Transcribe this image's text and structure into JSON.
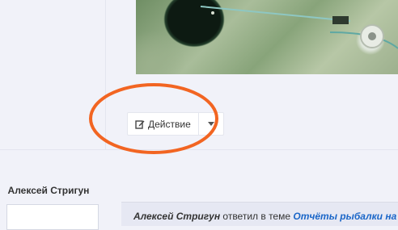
{
  "post": {
    "action_button": {
      "label": "Действие",
      "icon": "edit-icon"
    },
    "dropdown": {
      "icon": "caret-down-icon"
    }
  },
  "annotation": {
    "color": "#f26522"
  },
  "sidebar": {
    "author_name": "Алексей Стригун"
  },
  "activity": {
    "who": "Алексей Стригун",
    "verb": "ответил в теме",
    "topic": "Отчёты рыбалки на Ура"
  }
}
